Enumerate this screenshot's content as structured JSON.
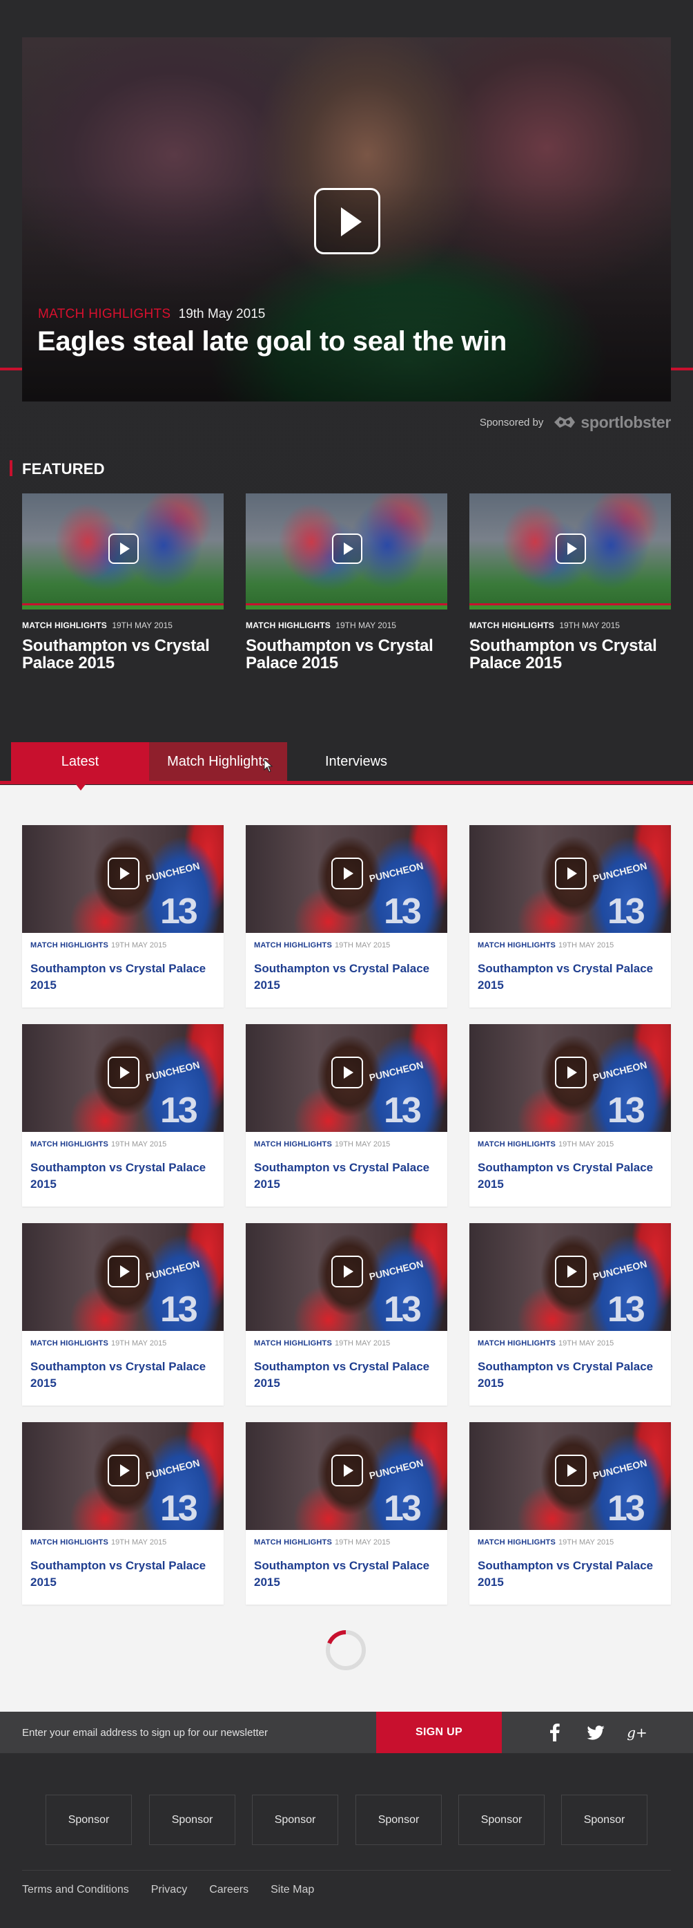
{
  "hero": {
    "category": "MATCH HIGHLIGHTS",
    "date": "19th May 2015",
    "title": "Eagles steal late goal to seal the win",
    "sponsored_label": "Sponsored by",
    "sponsor_name": "sportlobster"
  },
  "featured": {
    "heading": "FEATURED",
    "items": [
      {
        "category": "MATCH HIGHLIGHTS",
        "date": "19TH MAY 2015",
        "title": "Southampton vs Crystal Palace 2015"
      },
      {
        "category": "MATCH HIGHLIGHTS",
        "date": "19TH MAY 2015",
        "title": "Southampton vs Crystal Palace 2015"
      },
      {
        "category": "MATCH HIGHLIGHTS",
        "date": "19TH MAY 2015",
        "title": "Southampton vs Crystal Palace 2015"
      }
    ]
  },
  "tabs": [
    {
      "label": "Latest",
      "state": "active"
    },
    {
      "label": "Match Highlights",
      "state": "hover"
    },
    {
      "label": "Interviews",
      "state": "default"
    }
  ],
  "grid": {
    "shirt_name": "PUNCHEON",
    "shirt_number": "13",
    "items": [
      {
        "category": "MATCH HIGHLIGHTS",
        "date": "19TH MAY 2015",
        "title": "Southampton vs Crystal Palace 2015"
      },
      {
        "category": "MATCH HIGHLIGHTS",
        "date": "19TH MAY 2015",
        "title": "Southampton vs Crystal Palace 2015"
      },
      {
        "category": "MATCH HIGHLIGHTS",
        "date": "19TH MAY 2015",
        "title": "Southampton vs Crystal Palace 2015"
      },
      {
        "category": "MATCH HIGHLIGHTS",
        "date": "19TH MAY 2015",
        "title": "Southampton vs Crystal Palace 2015"
      },
      {
        "category": "MATCH HIGHLIGHTS",
        "date": "19TH MAY 2015",
        "title": "Southampton vs Crystal Palace 2015"
      },
      {
        "category": "MATCH HIGHLIGHTS",
        "date": "19TH MAY 2015",
        "title": "Southampton vs Crystal Palace 2015"
      },
      {
        "category": "MATCH HIGHLIGHTS",
        "date": "19TH MAY 2015",
        "title": "Southampton vs Crystal Palace 2015"
      },
      {
        "category": "MATCH HIGHLIGHTS",
        "date": "19TH MAY 2015",
        "title": "Southampton vs Crystal Palace 2015"
      },
      {
        "category": "MATCH HIGHLIGHTS",
        "date": "19TH MAY 2015",
        "title": "Southampton vs Crystal Palace 2015"
      },
      {
        "category": "MATCH HIGHLIGHTS",
        "date": "19TH MAY 2015",
        "title": "Southampton vs Crystal Palace 2015"
      },
      {
        "category": "MATCH HIGHLIGHTS",
        "date": "19TH MAY 2015",
        "title": "Southampton vs Crystal Palace 2015"
      },
      {
        "category": "MATCH HIGHLIGHTS",
        "date": "19TH MAY 2015",
        "title": "Southampton vs Crystal Palace 2015"
      }
    ]
  },
  "newsletter": {
    "placeholder": "Enter your email address to sign up for our newsletter",
    "button_label": "SIGN UP"
  },
  "social": [
    {
      "icon": "facebook-icon",
      "glyph": "f"
    },
    {
      "icon": "twitter-icon",
      "glyph": ""
    },
    {
      "icon": "google-plus-icon",
      "glyph": "g+"
    }
  ],
  "sponsors": [
    "Sponsor",
    "Sponsor",
    "Sponsor",
    "Sponsor",
    "Sponsor",
    "Sponsor"
  ],
  "footer_links": [
    "Terms and Conditions",
    "Privacy",
    "Careers",
    "Site Map"
  ],
  "colors": {
    "accent": "#c8102e",
    "dark_bg": "#2a2a2c",
    "link_blue": "#1e3d8f"
  }
}
